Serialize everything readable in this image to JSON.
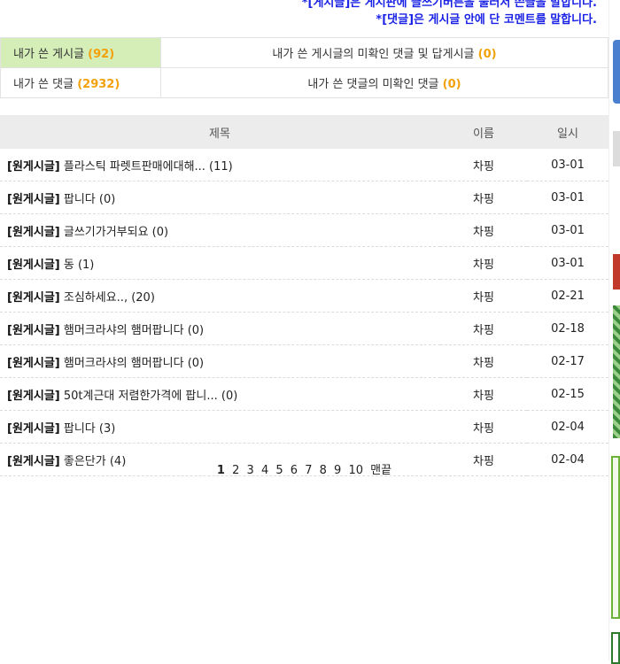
{
  "notice": {
    "line1": "*[게시글]은 게시판에 글쓰기버튼을 눌러서 쓴글을 말합니다.",
    "line2": "*[댓글]은 게시글 안에 단 코멘트를 말합니다."
  },
  "summary": {
    "my_posts_label": "내가 쓴 게시글",
    "my_posts_count": "(92)",
    "unread_comments_label": "내가 쓴 게시글의 미확인 댓글 및 답게시글",
    "unread_comments_count": "(0)",
    "my_comments_label": "내가 쓴 댓글",
    "my_comments_count": "(2932)",
    "unread_my_comments_label": "내가 쓴 댓글의 미확인 댓글",
    "unread_my_comments_count": "(0)"
  },
  "table": {
    "headers": {
      "title": "제목",
      "name": "이름",
      "date": "일시"
    },
    "rows": [
      {
        "tag": "[원게시글]",
        "title": "플라스틱 파렛트판매에대해... (11)",
        "name": "차핑",
        "date": "03-01"
      },
      {
        "tag": "[원게시글]",
        "title": "팝니다 (0)",
        "name": "차핑",
        "date": "03-01"
      },
      {
        "tag": "[원게시글]",
        "title": "글쓰기가거부되요 (0)",
        "name": "차핑",
        "date": "03-01"
      },
      {
        "tag": "[원게시글]",
        "title": "동 (1)",
        "name": "차핑",
        "date": "03-01"
      },
      {
        "tag": "[원게시글]",
        "title": "조심하세요.., (20)",
        "name": "차핑",
        "date": "02-21"
      },
      {
        "tag": "[원게시글]",
        "title": "햄머크라샤의 햄머팝니다 (0)",
        "name": "차핑",
        "date": "02-18"
      },
      {
        "tag": "[원게시글]",
        "title": "햄머크라샤의 햄머팝니다 (0)",
        "name": "차핑",
        "date": "02-17"
      },
      {
        "tag": "[원게시글]",
        "title": "50t계근대 저렴한가격에 팝니... (0)",
        "name": "차핑",
        "date": "02-15"
      },
      {
        "tag": "[원게시글]",
        "title": "팝니다 (3)",
        "name": "차핑",
        "date": "02-04"
      },
      {
        "tag": "[원게시글]",
        "title": "좋은단가 (4)",
        "name": "차핑",
        "date": "02-04"
      }
    ]
  },
  "pager": {
    "pages": [
      "1",
      "2",
      "3",
      "4",
      "5",
      "6",
      "7",
      "8",
      "9",
      "10"
    ],
    "last_label": "맨끝"
  }
}
